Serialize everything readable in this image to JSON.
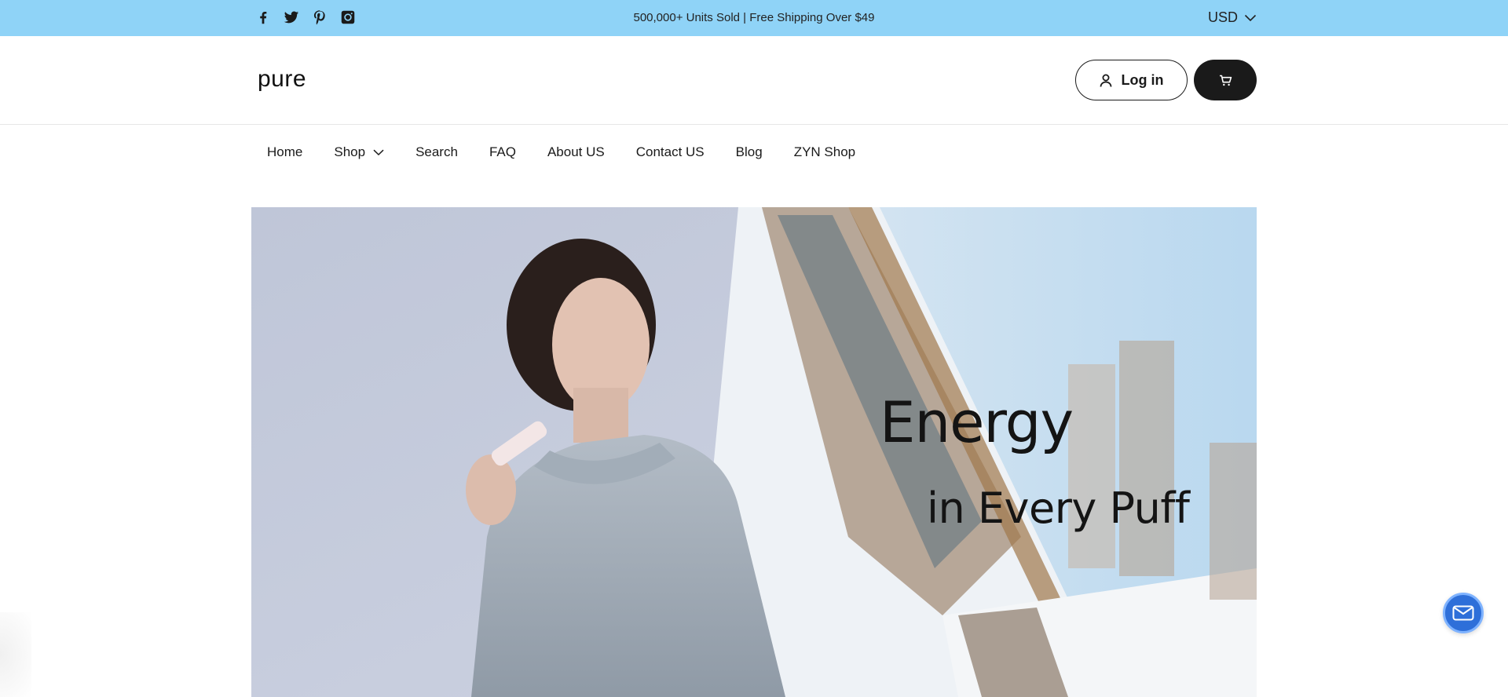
{
  "topbar": {
    "background": "#8fd3f7",
    "social_icons": [
      "facebook-icon",
      "twitter-icon",
      "pinterest-icon",
      "instagram-icon"
    ],
    "announcement": "500,000+ Units Sold | Free Shipping Over $49",
    "currency": "USD"
  },
  "header": {
    "logo": "pure",
    "login_label": "Log in",
    "cart_icon": "cart-icon"
  },
  "nav": {
    "items": [
      {
        "label": "Home"
      },
      {
        "label": "Shop"
      },
      {
        "label": "Search"
      },
      {
        "label": "FAQ"
      },
      {
        "label": "About US"
      },
      {
        "label": "Contact US"
      },
      {
        "label": "Blog"
      },
      {
        "label": "ZYN Shop"
      }
    ]
  },
  "hero": {
    "title": "Energy",
    "subtitle": "in Every Puff"
  },
  "chat": {
    "icon": "mail-icon",
    "color": "#2e6fd9"
  }
}
